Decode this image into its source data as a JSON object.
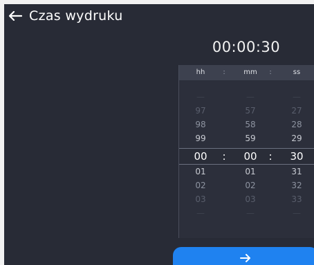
{
  "header": {
    "title": "Czas wydruku",
    "back_icon": "arrow-left-icon"
  },
  "time_display": "00:00:30",
  "picker": {
    "labels": {
      "hh": "hh",
      "mm": "mm",
      "ss": "ss",
      "sep": ":"
    },
    "rows": [
      {
        "hh": "—",
        "mm": "—",
        "ss": "—",
        "level": 1
      },
      {
        "hh": "97",
        "mm": "57",
        "ss": "27",
        "level": 2
      },
      {
        "hh": "98",
        "mm": "58",
        "ss": "28",
        "level": 3
      },
      {
        "hh": "99",
        "mm": "59",
        "ss": "29",
        "level": 4
      },
      {
        "hh": "00",
        "mm": "00",
        "ss": "30",
        "level": 5,
        "selected": true,
        "sep": ":"
      },
      {
        "hh": "01",
        "mm": "01",
        "ss": "31",
        "level": 4
      },
      {
        "hh": "02",
        "mm": "02",
        "ss": "32",
        "level": 3
      },
      {
        "hh": "03",
        "mm": "03",
        "ss": "33",
        "level": 2
      },
      {
        "hh": "—",
        "mm": "—",
        "ss": "—",
        "level": 1
      }
    ]
  },
  "confirm_button": {
    "icon": "arrow-right-icon",
    "color": "#1f82f0"
  }
}
